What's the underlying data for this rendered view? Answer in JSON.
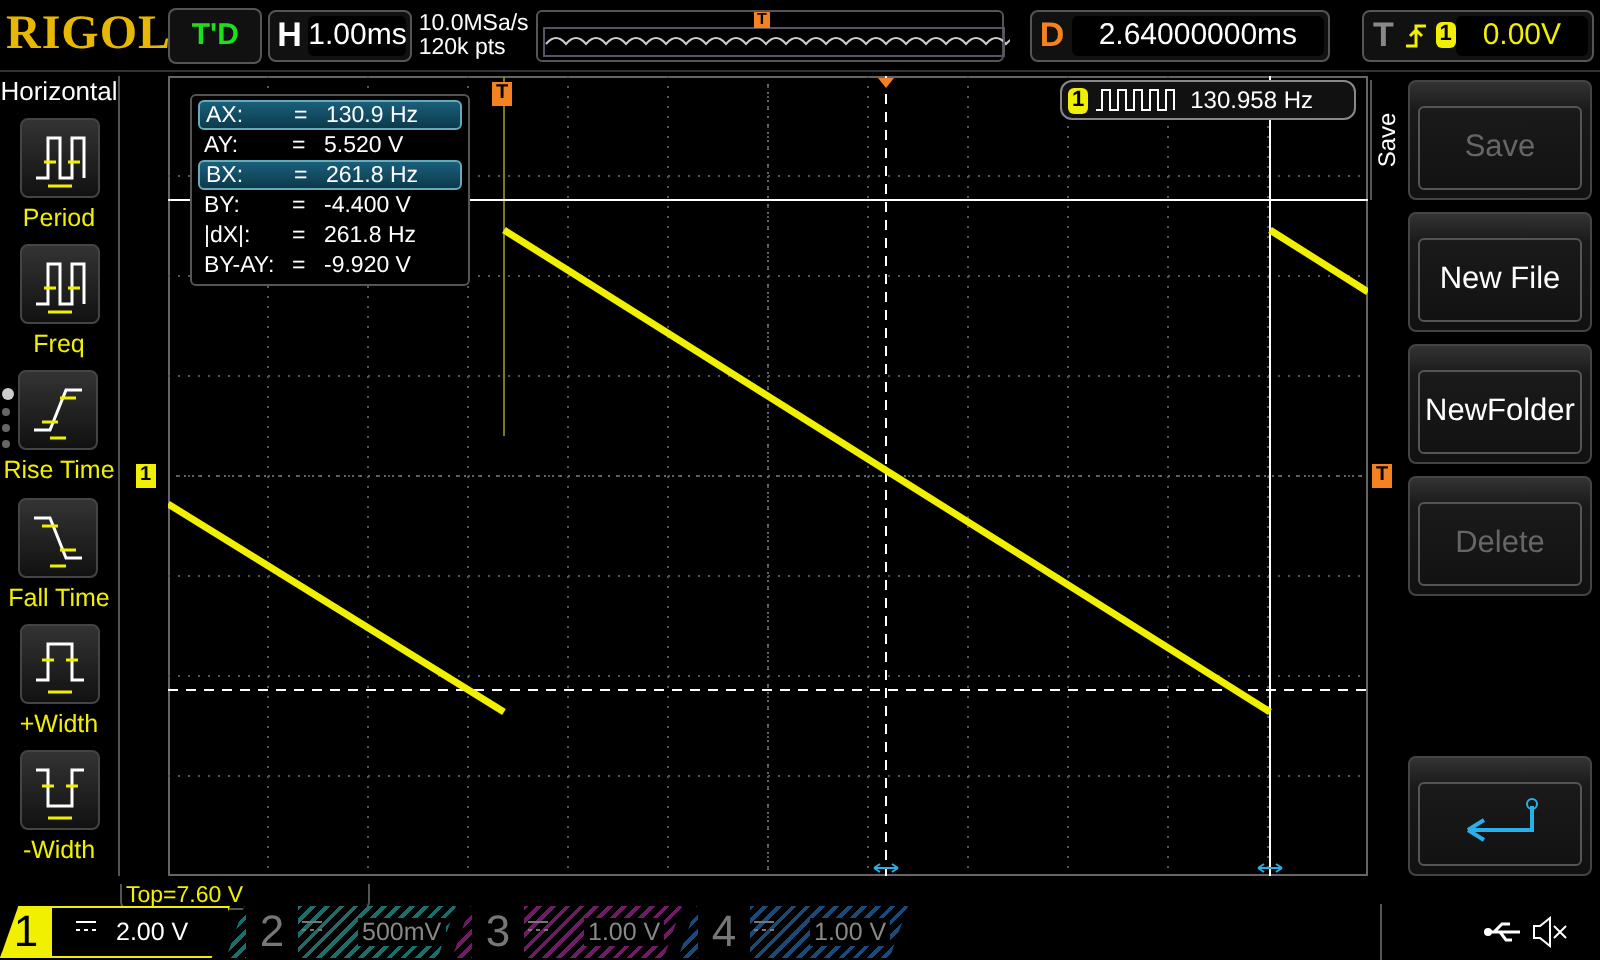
{
  "brand": "RIGOL",
  "run_status": "T'D",
  "horizontal": {
    "letter": "H",
    "timebase": "1.00ms"
  },
  "acquisition": {
    "sample_rate": "10.0MSa/s",
    "memory_depth": "120k pts",
    "overview_marker": "T"
  },
  "delay": {
    "letter": "D",
    "value": "2.64000000ms"
  },
  "trigger": {
    "letter": "T",
    "source": "1",
    "level": "0.00V"
  },
  "left_menu": {
    "title": "Horizontal",
    "items": [
      {
        "label": "Period",
        "kind": "period"
      },
      {
        "label": "Freq",
        "kind": "freq"
      },
      {
        "label": "Rise Time",
        "kind": "rise"
      },
      {
        "label": "Fall Time",
        "kind": "fall"
      },
      {
        "label": "+Width",
        "kind": "pwidth"
      },
      {
        "label": "-Width",
        "kind": "nwidth"
      }
    ],
    "pages": [
      {
        "selected": true
      },
      {
        "selected": false
      },
      {
        "selected": false
      },
      {
        "selected": false
      }
    ]
  },
  "plot": {
    "trigger_marker": "T",
    "channel_marker": "1",
    "level_marker": "T",
    "cursor_readout": [
      {
        "label": "AX:",
        "eq": "=",
        "value": "130.9 Hz",
        "selected": true
      },
      {
        "label": "AY:",
        "eq": "=",
        "value": "5.520 V",
        "selected": false
      },
      {
        "label": "BX:",
        "eq": "=",
        "value": "261.8 Hz",
        "selected": true
      },
      {
        "label": "BY:",
        "eq": "=",
        "value": "-4.400 V",
        "selected": false
      },
      {
        "label": "|dX|:",
        "eq": "=",
        "value": "261.8 Hz",
        "selected": false
      },
      {
        "label": "BY-AY:",
        "eq": "=",
        "value": "-9.920 V",
        "selected": false
      }
    ],
    "measurement": {
      "channel": "1",
      "value": "130.958 Hz"
    },
    "offset_label": "Top=7.60 V"
  },
  "softkeys": {
    "title": "Save",
    "keys": [
      {
        "kind": "text",
        "label": "Save",
        "disabled": true
      },
      {
        "kind": "text",
        "label": "New File",
        "disabled": false
      },
      {
        "kind": "text",
        "label": "NewFolder",
        "disabled": false
      },
      {
        "kind": "text",
        "label": "Delete",
        "disabled": true
      },
      {
        "kind": "back"
      }
    ]
  },
  "channels": [
    {
      "number": "1",
      "scale": "2.00 V",
      "active": true,
      "color": "#f0f000"
    },
    {
      "number": "2",
      "scale": "500mV",
      "active": false,
      "color": "#1c6e6a"
    },
    {
      "number": "3",
      "scale": "1.00 V",
      "active": false,
      "color": "#6e1c64"
    },
    {
      "number": "4",
      "scale": "1.00 V",
      "active": false,
      "color": "#1c4a78"
    }
  ]
}
